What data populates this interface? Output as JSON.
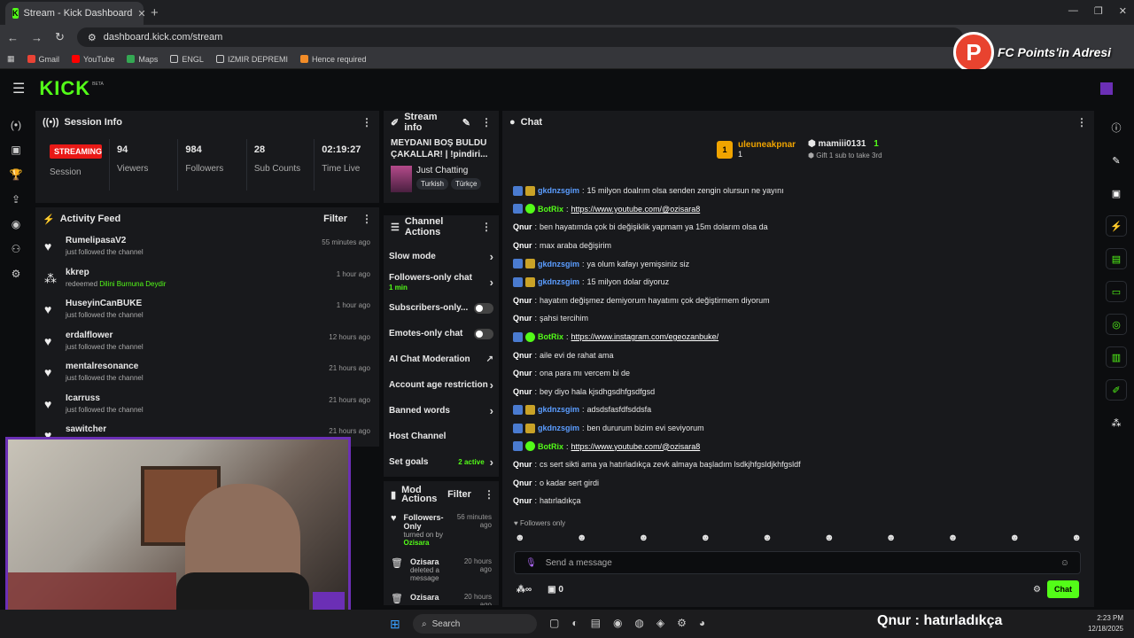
{
  "browser": {
    "tab_title": "Stream - Kick Dashboard",
    "url": "dashboard.kick.com/stream",
    "bookmarks": [
      "Gmail",
      "YouTube",
      "Maps",
      "ENGL",
      "IZMIR DEPREMI",
      "Hence required"
    ]
  },
  "overlay": {
    "fc_letter": "P",
    "fc_text": "FC Points'in Adresi"
  },
  "kick": {
    "logo": "KICK",
    "beta": "BETA"
  },
  "session": {
    "title": "Session Info",
    "live_badge": "STREAMING",
    "session_label": "Session",
    "stats": [
      {
        "value": "94",
        "label": "Viewers"
      },
      {
        "value": "984",
        "label": "Followers"
      },
      {
        "value": "28",
        "label": "Sub Counts"
      },
      {
        "value": "02:19:27",
        "label": "Time Live"
      }
    ]
  },
  "activity": {
    "title": "Activity Feed",
    "filter": "Filter",
    "items": [
      {
        "name": "RumelipasaV2",
        "desc": "just followed the channel",
        "highlight": "",
        "time": "55 minutes ago"
      },
      {
        "name": "kkrep",
        "desc": "redeemed ",
        "highlight": "Dilini Burnuna Deydir",
        "time": "1 hour ago"
      },
      {
        "name": "HuseyinCanBUKE",
        "desc": "just followed the channel",
        "highlight": "",
        "time": "1 hour ago"
      },
      {
        "name": "erdalflower",
        "desc": "just followed the channel",
        "highlight": "",
        "time": "12 hours ago"
      },
      {
        "name": "mentalresonance",
        "desc": "just followed the channel",
        "highlight": "",
        "time": "21 hours ago"
      },
      {
        "name": "Icarruss",
        "desc": "just followed the channel",
        "highlight": "",
        "time": "21 hours ago"
      },
      {
        "name": "sawitcher",
        "desc": "just followed the channel",
        "highlight": "",
        "time": "21 hours ago"
      }
    ]
  },
  "stream_info": {
    "title": "Stream info",
    "stream_title": "MEYDANI BOŞ BULDU ÇAKALLAR! | !pindiri...",
    "category": "Just Chatting",
    "tags": [
      "Turkish",
      "Türkçe"
    ]
  },
  "channel_actions": {
    "title": "Channel Actions",
    "slow_mode": "Slow mode",
    "followers_only": "Followers-only chat",
    "followers_only_value": "1 min",
    "subscribers_only": "Subscribers-only...",
    "emotes_only": "Emotes-only chat",
    "ai_moderation": "AI Chat Moderation",
    "account_age": "Account age restriction",
    "banned_words": "Banned words",
    "host_channel": "Host Channel",
    "set_goals": "Set goals",
    "goals_active": "2 active"
  },
  "mod_actions": {
    "title": "Mod Actions",
    "filter": "Filter",
    "items": [
      {
        "name": "Followers-Only",
        "desc": "turned on by ",
        "by": "Ozisara",
        "time": "56 minutes ago"
      },
      {
        "name": "Ozisara",
        "desc": "deleted a message",
        "by": "",
        "time": "20 hours ago"
      },
      {
        "name": "Ozisara",
        "desc": "",
        "by": "",
        "time": "20 hours ago"
      }
    ]
  },
  "chat": {
    "title": "Chat",
    "top1": "uleuneakpnar",
    "top1_count": "1",
    "top2": "mamiii0131",
    "top2_count": "1",
    "gift_hint": "Gift 1 sub to take 3rd",
    "messages": [
      {
        "user": "gkdnzsgim",
        "color": "#5b9dff",
        "text": "15 milyon doalrım olsa senden zengin olursun ne yayını",
        "link": false
      },
      {
        "user": "BotRix",
        "color": "#53fc18",
        "text": "https://www.youtube.com/@ozisara8",
        "link": true
      },
      {
        "user": "Qnur",
        "color": "#ffffff",
        "text": "ben hayatımda çok bi değişiklik yapmam ya 15m dolarım olsa da",
        "link": false
      },
      {
        "user": "Qnur",
        "color": "#ffffff",
        "text": "max araba değişirim",
        "link": false
      },
      {
        "user": "gkdnzsgim",
        "color": "#5b9dff",
        "text": "ya olum kafayı yemişsiniz siz",
        "link": false
      },
      {
        "user": "gkdnzsgim",
        "color": "#5b9dff",
        "text": "15 milyon dolar diyoruz",
        "link": false
      },
      {
        "user": "Qnur",
        "color": "#ffffff",
        "text": "hayatım değişmez demiyorum hayatımı çok değiştirmem diyorum",
        "link": false
      },
      {
        "user": "Qnur",
        "color": "#ffffff",
        "text": "şahsi tercihim",
        "link": false
      },
      {
        "user": "BotRix",
        "color": "#53fc18",
        "text": "https://www.instagram.com/egeozanbuke/",
        "link": true
      },
      {
        "user": "Qnur",
        "color": "#ffffff",
        "text": "aile evi de rahat ama",
        "link": false
      },
      {
        "user": "Qnur",
        "color": "#ffffff",
        "text": "ona para mı vercem bi de",
        "link": false
      },
      {
        "user": "Qnur",
        "color": "#ffffff",
        "text": "bey diyo hala kjsdhgsdhfgsdfgsd",
        "link": false
      },
      {
        "user": "gkdnzsgim",
        "color": "#5b9dff",
        "text": "adsdsfasfdfsddsfa",
        "link": false
      },
      {
        "user": "gkdnzsgim",
        "color": "#5b9dff",
        "text": "ben dururum bizim evi seviyorum",
        "link": false
      },
      {
        "user": "BotRix",
        "color": "#53fc18",
        "text": "https://www.youtube.com/@ozisara8",
        "link": true
      },
      {
        "user": "Qnur",
        "color": "#ffffff",
        "text": "cs sert sikti ama ya hatırladıkça zevk almaya başladım lsdkjhfgsldjkhfgsldf",
        "link": false
      },
      {
        "user": "Qnur",
        "color": "#ffffff",
        "text": "o kadar sert girdi",
        "link": false
      },
      {
        "user": "Qnur",
        "color": "#ffffff",
        "text": "hatırladıkça",
        "link": false
      }
    ],
    "followers_only_label": "Followers only",
    "input_placeholder": "Send a message",
    "count": "0",
    "send_label": "Chat"
  },
  "caption": "Qnur : hatırladıkça",
  "taskbar": {
    "search": "Search",
    "time": "2:23 PM",
    "date": "12/18/2025"
  },
  "colors": {
    "accent": "#53fc18",
    "live": "#e91916",
    "panel": "#18191c",
    "bg": "#0c0d0f"
  }
}
